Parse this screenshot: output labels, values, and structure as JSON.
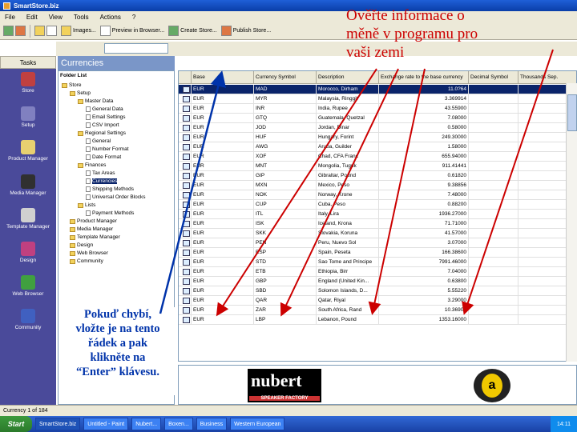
{
  "window": {
    "title": "SmartStore.biz"
  },
  "menu": [
    "File",
    "Edit",
    "View",
    "Tools",
    "Actions",
    "?"
  ],
  "toolbar": {
    "items": [
      "Images...",
      "Preview in Browser...",
      "Create Store...",
      "Publish Store..."
    ],
    "dropdown_value": ""
  },
  "left_nav": {
    "header": "Tasks",
    "items": [
      {
        "label": "Store",
        "icon": "store-icon",
        "color": "#c04040"
      },
      {
        "label": "Setup",
        "icon": "setup-icon",
        "color": "#8080c0"
      },
      {
        "label": "Product Manager",
        "icon": "product-manager-icon",
        "color": "#e8d070"
      },
      {
        "label": "Media Manager",
        "icon": "media-manager-icon",
        "color": "#303030"
      },
      {
        "label": "Template Manager",
        "icon": "template-manager-icon",
        "color": "#d0d0d0"
      },
      {
        "label": "Design",
        "icon": "design-icon",
        "color": "#c04080"
      },
      {
        "label": "Web Browser",
        "icon": "web-browser-icon",
        "color": "#40a040"
      },
      {
        "label": "Community",
        "icon": "community-icon",
        "color": "#4060c0"
      }
    ]
  },
  "panel": {
    "title": "Currencies"
  },
  "tree": {
    "header": "Folder List",
    "nodes": [
      {
        "label": "Store",
        "indent": 0,
        "kind": "root"
      },
      {
        "label": "Setup",
        "indent": 1,
        "kind": "folder"
      },
      {
        "label": "Master Data",
        "indent": 2,
        "kind": "folder"
      },
      {
        "label": "General Data",
        "indent": 3,
        "kind": "page"
      },
      {
        "label": "Email Settings",
        "indent": 3,
        "kind": "page"
      },
      {
        "label": "CSV Import",
        "indent": 3,
        "kind": "page"
      },
      {
        "label": "Regional Settings",
        "indent": 2,
        "kind": "folder"
      },
      {
        "label": "General",
        "indent": 3,
        "kind": "page"
      },
      {
        "label": "Number Format",
        "indent": 3,
        "kind": "page"
      },
      {
        "label": "Date Format",
        "indent": 3,
        "kind": "page"
      },
      {
        "label": "Finances",
        "indent": 2,
        "kind": "folder"
      },
      {
        "label": "Tax Areas",
        "indent": 3,
        "kind": "page"
      },
      {
        "label": "Currencies",
        "indent": 3,
        "kind": "page",
        "selected": true
      },
      {
        "label": "Shipping Methods",
        "indent": 3,
        "kind": "page"
      },
      {
        "label": "Universal Order Blocks",
        "indent": 3,
        "kind": "page"
      },
      {
        "label": "Lists",
        "indent": 2,
        "kind": "folder"
      },
      {
        "label": "Payment Methods",
        "indent": 3,
        "kind": "page"
      },
      {
        "label": "Product Manager",
        "indent": 1,
        "kind": "folder"
      },
      {
        "label": "Media Manager",
        "indent": 1,
        "kind": "folder"
      },
      {
        "label": "Template Manager",
        "indent": 1,
        "kind": "folder"
      },
      {
        "label": "Design",
        "indent": 1,
        "kind": "folder"
      },
      {
        "label": "Web Browser",
        "indent": 1,
        "kind": "folder"
      },
      {
        "label": "Community",
        "indent": 1,
        "kind": "folder"
      }
    ]
  },
  "grid": {
    "columns": [
      "Base",
      "Currency Symbol",
      "Description",
      "Exchange rate to the base currency",
      "Decimal Symbol",
      "Thousands Sep."
    ],
    "rows": [
      {
        "base": "EUR",
        "symbol": "MAD",
        "desc": "Morocco, Dirham",
        "rate": "11.0?64",
        "selected": true
      },
      {
        "base": "EUR",
        "symbol": "MYR",
        "desc": "Malaysia, Ringgit",
        "rate": "3.369914"
      },
      {
        "base": "EUR",
        "symbol": "INR",
        "desc": "India, Rupee",
        "rate": "43.55900"
      },
      {
        "base": "EUR",
        "symbol": "GTQ",
        "desc": "Guatemala, Quetzal",
        "rate": "7.08000"
      },
      {
        "base": "EUR",
        "symbol": "JOD",
        "desc": "Jordan, Dinar",
        "rate": "0.58000"
      },
      {
        "base": "EUR",
        "symbol": "HUF",
        "desc": "Hungary, Forint",
        "rate": "249.30000"
      },
      {
        "base": "EUR",
        "symbol": "AWG",
        "desc": "Aruba, Guilder",
        "rate": "1.58000"
      },
      {
        "base": "EUR",
        "symbol": "XOF",
        "desc": "Chad, CFA Franc",
        "rate": "655.94000"
      },
      {
        "base": "EUR",
        "symbol": "MNT",
        "desc": "Mongolia, Tugrik",
        "rate": "911.41441"
      },
      {
        "base": "EUR",
        "symbol": "GIP",
        "desc": "Gibraltar, Pound",
        "rate": "0.61820"
      },
      {
        "base": "EUR",
        "symbol": "MXN",
        "desc": "Mexico, Peso",
        "rate": "9.38856"
      },
      {
        "base": "EUR",
        "symbol": "NOK",
        "desc": "Norway, Krone",
        "rate": "7.48000"
      },
      {
        "base": "EUR",
        "symbol": "CUP",
        "desc": "Cuba, Peso",
        "rate": "0.88200"
      },
      {
        "base": "EUR",
        "symbol": "ITL",
        "desc": "Italy, Lira",
        "rate": "1936.27000"
      },
      {
        "base": "EUR",
        "symbol": "ISK",
        "desc": "Iceland, Krona",
        "rate": "71.71000"
      },
      {
        "base": "EUR",
        "symbol": "SKK",
        "desc": "Slovakia, Koruna",
        "rate": "41.57000"
      },
      {
        "base": "EUR",
        "symbol": "PEN",
        "desc": "Peru, Nuevo Sol",
        "rate": "3.07000"
      },
      {
        "base": "EUR",
        "symbol": "ESP",
        "desc": "Spain, Peseta",
        "rate": "166.38600"
      },
      {
        "base": "EUR",
        "symbol": "STD",
        "desc": "Sao Tome and Principe",
        "rate": "7991.46000"
      },
      {
        "base": "EUR",
        "symbol": "ETB",
        "desc": "Ethiopia, Birr",
        "rate": "7.04000"
      },
      {
        "base": "EUR",
        "symbol": "GBP",
        "desc": "England (United Kin...",
        "rate": "0.63800"
      },
      {
        "base": "EUR",
        "symbol": "SBD",
        "desc": "Solomon Islands, D...",
        "rate": "5.55220"
      },
      {
        "base": "EUR",
        "symbol": "QAR",
        "desc": "Qatar, Riyal",
        "rate": "3.29000"
      },
      {
        "base": "EUR",
        "symbol": "ZAR",
        "desc": "South Africa, Rand",
        "rate": "10.36900"
      },
      {
        "base": "EUR",
        "symbol": "LBP",
        "desc": "Lebanon, Pound",
        "rate": "1353.16000"
      }
    ]
  },
  "ads": {
    "brand": "nubert",
    "tagline": "SPEAKER FACTORY",
    "logo_letter": "a"
  },
  "status": {
    "left": "Currency 1 of 184",
    "panels": [
      "",
      "",
      ""
    ]
  },
  "taskbar": {
    "start": "Start",
    "tasks": [
      "SmartStore.biz",
      "Untitled - Paint",
      "Nubert...",
      "Boxen..."
    ],
    "clock": "14:11",
    "extra": [
      "Business",
      "Western European"
    ]
  },
  "annotations": {
    "top": "Ověřte informace o\nměně v programu pro\nvaši zemi",
    "bottom": "Pokuď chybí,\nvložte je na tento\nřádek a pak\nklikněte na\n“Enter” klávesu."
  },
  "colors": {
    "annotation_top": "#cc0000",
    "annotation_bottom": "#0033aa",
    "selection": "#0a246a",
    "nav_bg": "#4a4a9a"
  }
}
